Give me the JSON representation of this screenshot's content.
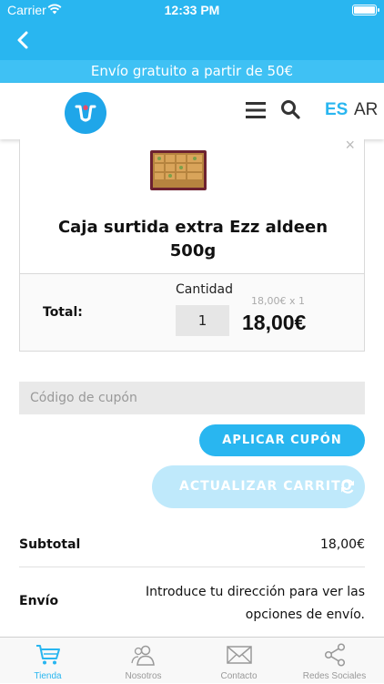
{
  "status_bar": {
    "carrier": "Carrier",
    "time": "12:33 PM"
  },
  "promo_banner": {
    "text": "Envío gratuito a partir de 50€"
  },
  "header": {
    "lang_es": "ES",
    "lang_ar": "AR"
  },
  "cart_item": {
    "close": "×",
    "name_line1": "Caja surtida extra Ezz aldeen",
    "name_line2": "500g",
    "total_label": "Total:",
    "quantity_label": "Cantidad",
    "quantity_value": "1",
    "unit_price": "18,00€ x 1",
    "line_total": "18,00€"
  },
  "coupon": {
    "placeholder": "Código de cupón",
    "apply_label": "APLICAR CUPÓN"
  },
  "update_cart": {
    "label": "ACTUALIZAR CARRITO"
  },
  "summary": {
    "subtotal_label": "Subtotal",
    "subtotal_value": "18,00€",
    "shipping_label": "Envío",
    "shipping_line1": "Introduce tu dirección para ver las",
    "shipping_line2": "opciones de envío."
  },
  "tabs": [
    {
      "label": "Tienda",
      "icon": "cart-icon",
      "active": true
    },
    {
      "label": "Nosotros",
      "icon": "users-icon",
      "active": false
    },
    {
      "label": "Contacto",
      "icon": "mail-icon",
      "active": false
    },
    {
      "label": "Redes Sociales",
      "icon": "share-icon",
      "active": false
    }
  ],
  "colors": {
    "accent": "#29b6f0",
    "promo": "#3fc1f4",
    "disabled_button": "#bfe9fb"
  }
}
